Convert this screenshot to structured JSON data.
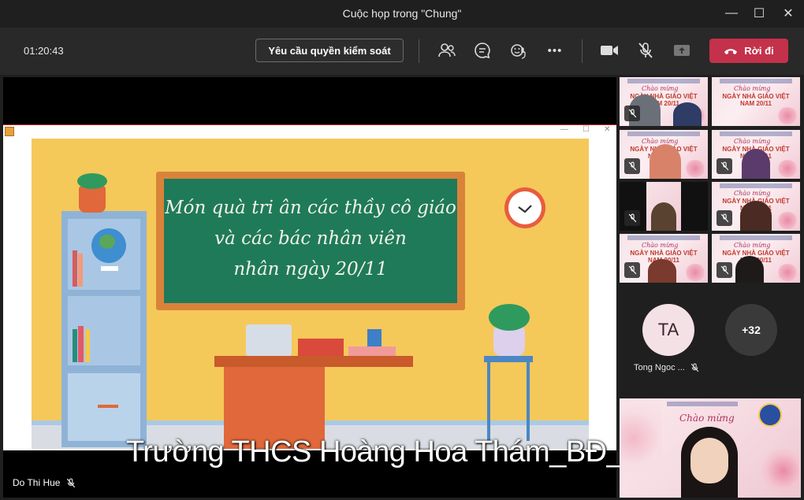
{
  "window": {
    "title": "Cuộc họp trong \"Chung\"",
    "minimize": "—",
    "maximize": "☐",
    "close": "✕"
  },
  "toolbar": {
    "timer": "01:20:43",
    "request_control": "Yêu cầu quyền kiểm soát",
    "more": "•••",
    "leave": "Rời đi",
    "leave_color": "#c4314b"
  },
  "slide": {
    "line1": "Món quà tri ân các thầy cô giáo",
    "line2": "và các bác nhân viên",
    "line3": "nhân ngày 20/11"
  },
  "stage": {
    "caption": "Trường THCS Hoàng Hoa Thám_BĐ_HN",
    "presenter": "Do Thi Hue"
  },
  "gallery": {
    "tile_script": "Chào mừng",
    "tile_banner": "NGÀY NHÀ GIÁO VIỆT NAM 20/11",
    "avatar_initials": "TA",
    "avatar_name": "Tong Ngoc ...",
    "overflow": "+32"
  }
}
